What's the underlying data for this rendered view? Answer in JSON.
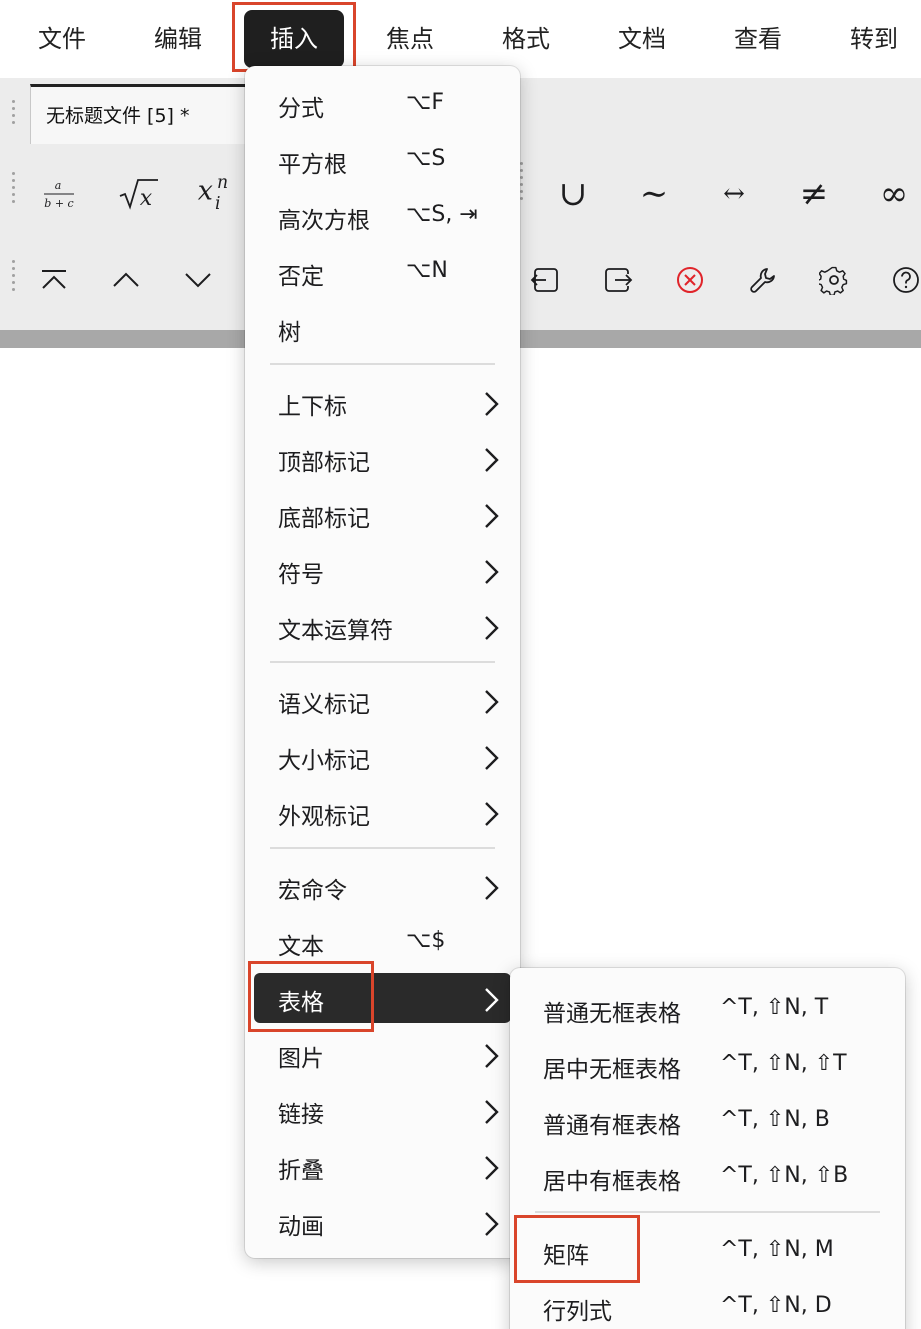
{
  "menubar": {
    "items": [
      "文件",
      "编辑",
      "插入",
      "焦点",
      "格式",
      "文档",
      "查看",
      "转到"
    ],
    "active_index": 2
  },
  "document_tab": {
    "title": "无标题文件 [5] *"
  },
  "toolbar_row1": {
    "left_icons": [
      "fraction-icon",
      "sqrt-icon",
      "subsup-icon"
    ],
    "right_symbols": [
      "∪",
      "∼",
      "↔",
      "≠",
      "∞"
    ]
  },
  "toolbar_row2": {
    "left_icons": [
      "caret-top-icon",
      "caret-up-icon",
      "caret-down-icon"
    ],
    "right_icons": [
      "import-icon",
      "export-icon",
      "cancel-icon",
      "wrench-icon",
      "gear-icon",
      "help-icon"
    ]
  },
  "insert_menu": {
    "groups": [
      [
        {
          "label": "分式",
          "shortcut": "⌥F",
          "submenu": false
        },
        {
          "label": "平方根",
          "shortcut": "⌥S",
          "submenu": false
        },
        {
          "label": "高次方根",
          "shortcut": "⌥S, ⇥",
          "submenu": false
        },
        {
          "label": "否定",
          "shortcut": "⌥N",
          "submenu": false
        },
        {
          "label": "树",
          "shortcut": "",
          "submenu": false
        }
      ],
      [
        {
          "label": "上下标",
          "shortcut": "",
          "submenu": true
        },
        {
          "label": "顶部标记",
          "shortcut": "",
          "submenu": true
        },
        {
          "label": "底部标记",
          "shortcut": "",
          "submenu": true
        },
        {
          "label": "符号",
          "shortcut": "",
          "submenu": true
        },
        {
          "label": "文本运算符",
          "shortcut": "",
          "submenu": true
        }
      ],
      [
        {
          "label": "语义标记",
          "shortcut": "",
          "submenu": true
        },
        {
          "label": "大小标记",
          "shortcut": "",
          "submenu": true
        },
        {
          "label": "外观标记",
          "shortcut": "",
          "submenu": true
        }
      ],
      [
        {
          "label": "宏命令",
          "shortcut": "",
          "submenu": true
        },
        {
          "label": "文本",
          "shortcut": "⌥$",
          "submenu": false
        },
        {
          "label": "表格",
          "shortcut": "",
          "submenu": true,
          "selected": true
        },
        {
          "label": "图片",
          "shortcut": "",
          "submenu": true
        },
        {
          "label": "链接",
          "shortcut": "",
          "submenu": true
        },
        {
          "label": "折叠",
          "shortcut": "",
          "submenu": true
        },
        {
          "label": "动画",
          "shortcut": "",
          "submenu": true
        }
      ]
    ]
  },
  "table_submenu": {
    "items": [
      {
        "label": "普通无框表格",
        "shortcut": "^T, ⇧N, T"
      },
      {
        "label": "居中无框表格",
        "shortcut": "^T, ⇧N, ⇧T"
      },
      {
        "label": "普通有框表格",
        "shortcut": "^T, ⇧N, B"
      },
      {
        "label": "居中有框表格",
        "shortcut": "^T, ⇧N, ⇧B"
      },
      {
        "label": "矩阵",
        "shortcut": "^T, ⇧N, M"
      },
      {
        "label": "行列式",
        "shortcut": "^T, ⇧N, D"
      }
    ]
  },
  "colors": {
    "highlight_box": "#d9452b",
    "selected_bg": "#2a2a2a",
    "cancel_icon": "#e0242a"
  }
}
